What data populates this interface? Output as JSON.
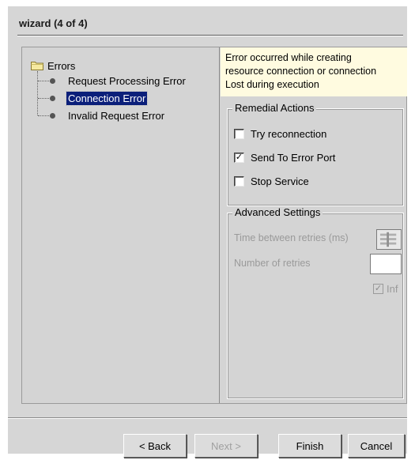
{
  "window": {
    "title": "wizard (4 of 4)"
  },
  "tree": {
    "root_label": "Errors",
    "items": [
      {
        "label": "Request Processing Error",
        "selected": false
      },
      {
        "label": "Connection Error",
        "selected": true
      },
      {
        "label": "Invalid Request Error",
        "selected": false
      }
    ]
  },
  "description": {
    "line1": "Error occurred while creating",
    "line2": "resource connection or connection",
    "line3": "Lost during execution"
  },
  "remedial": {
    "title": "Remedial Actions",
    "try_reconnection": {
      "label": "Try reconnection",
      "checked": false
    },
    "send_to_error_port": {
      "label": "Send To Error Port",
      "checked": true
    },
    "stop_service": {
      "label": "Stop Service",
      "checked": false
    }
  },
  "advanced": {
    "title": "Advanced Settings",
    "time_between_retries_label": "Time between retries (ms)",
    "number_of_retries_label": "Number of retries",
    "inf_label": "Inf",
    "inf_checked": true
  },
  "buttons": {
    "back": "< Back",
    "next": "Next >",
    "finish": "Finish",
    "cancel": "Cancel"
  },
  "colors": {
    "selection": "#0b1f7a",
    "description_bg": "#fffbe0",
    "panel_bg": "#d4d4d4"
  }
}
